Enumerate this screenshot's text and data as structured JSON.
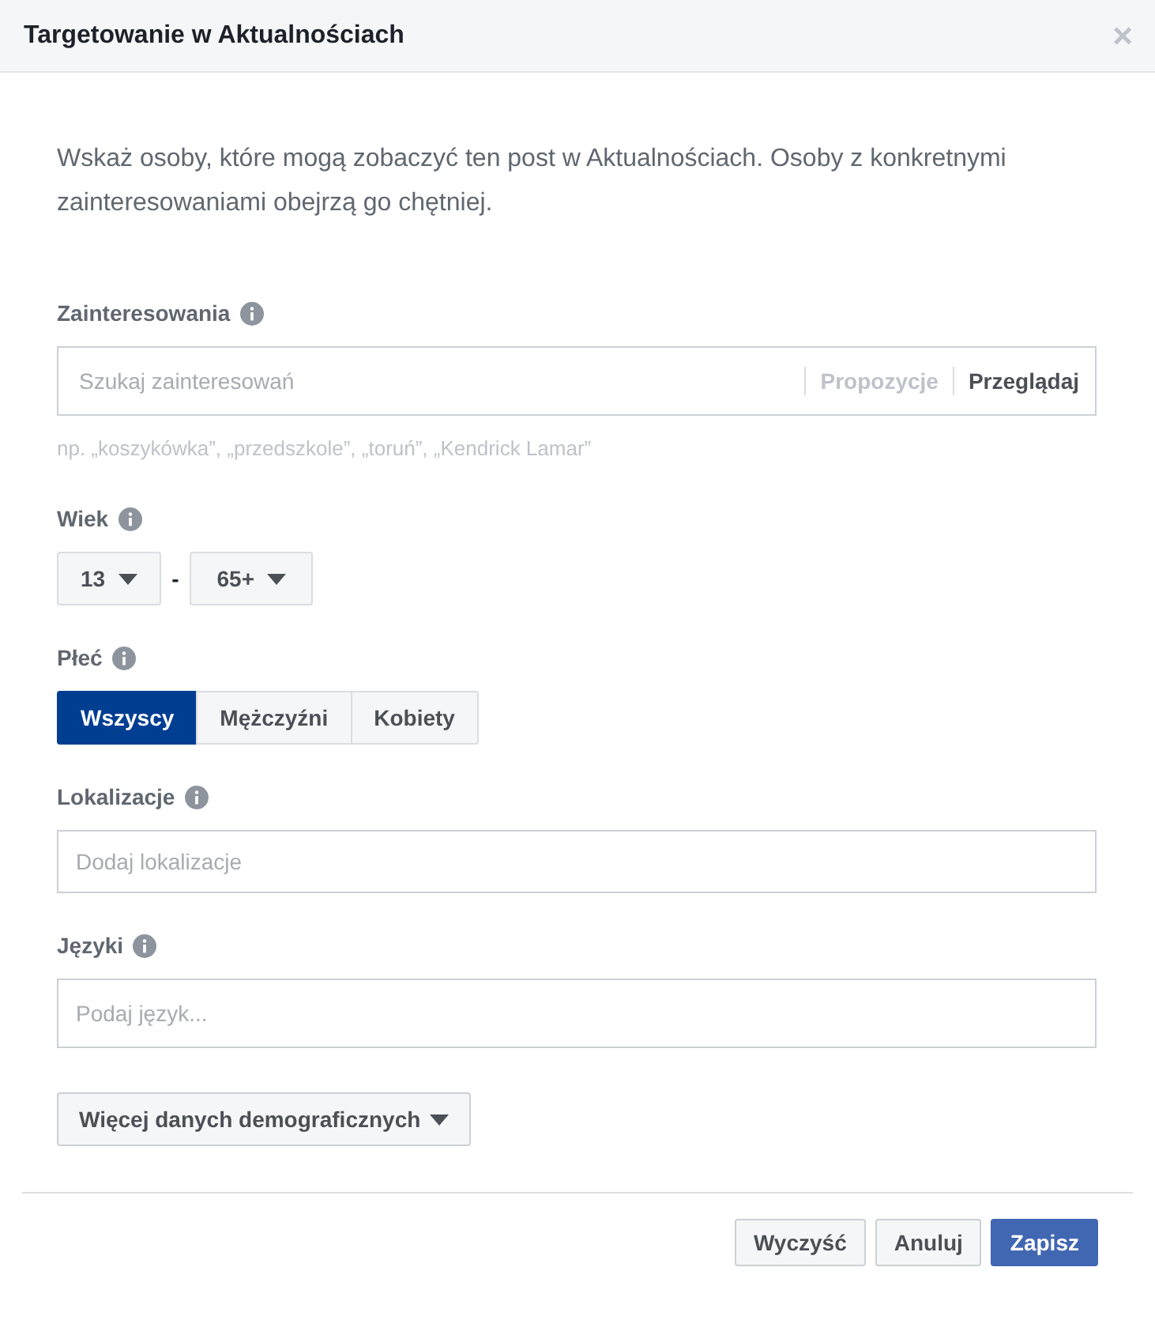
{
  "dialog": {
    "title": "Targetowanie w Aktualnościach",
    "close": "×"
  },
  "intro": "Wskaż osoby, które mogą zobaczyć ten post w Aktualnościach. Osoby z konkretnymi zainteresowaniami obejrzą go chętniej.",
  "interests": {
    "label": "Zainteresowania",
    "placeholder": "Szukaj zainteresowań",
    "actions": [
      {
        "label": "Propozycje",
        "disabled": true
      },
      {
        "label": "Przeglądaj",
        "disabled": false
      }
    ],
    "hint": "np. „koszykówka”, „przedszkole”, „toruń”, „Kendrick Lamar”"
  },
  "age": {
    "label": "Wiek",
    "min": "13",
    "separator": "-",
    "max": "65+"
  },
  "gender": {
    "label": "Płeć",
    "options": [
      {
        "label": "Wszyscy",
        "selected": true
      },
      {
        "label": "Mężczyźni",
        "selected": false
      },
      {
        "label": "Kobiety",
        "selected": false
      }
    ]
  },
  "locations": {
    "label": "Lokalizacje",
    "placeholder": "Dodaj lokalizacje"
  },
  "languages": {
    "label": "Języki",
    "placeholder": "Podaj język..."
  },
  "more_button": "Więcej danych demograficznych",
  "footer": {
    "buttons": [
      {
        "label": "Wyczyść",
        "kind": "secondary"
      },
      {
        "label": "Anuluj",
        "kind": "secondary"
      },
      {
        "label": "Zapisz",
        "kind": "primary"
      }
    ]
  }
}
